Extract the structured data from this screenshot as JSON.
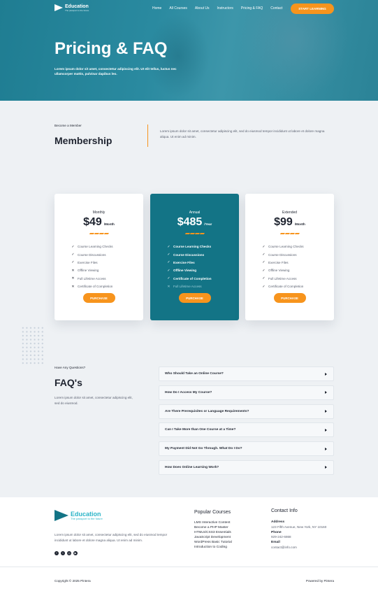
{
  "nav": {
    "logo_name": "Education",
    "logo_tagline": "The passport to the future",
    "links": [
      "Home",
      "All Courses",
      "About Us",
      "Instructors",
      "Pricing & FAQ",
      "Contact"
    ],
    "cta": "START LEARNING"
  },
  "hero": {
    "title": "Pricing & FAQ",
    "subtitle": "Lorem ipsum dolor sit amet, consectetur adipiscing elit. Ut elit tellus, luctus nec ullamcorper mattis, pulvinar dapibus leo."
  },
  "membership": {
    "eyebrow": "Become a Member",
    "title": "Membership",
    "text": "Lorem ipsum dolor sit amet, consectetur adipiscing elit, sed do eiusmod tempor incididunt ut labore et dolore magna aliqua. Ut enim ad minim."
  },
  "plans": [
    {
      "name": "Monthly",
      "price": "$49",
      "period": "/Month",
      "button": "PURCHASE",
      "features": [
        {
          "label": "Course Learning Checks",
          "included": true
        },
        {
          "label": "Course Discussions",
          "included": true
        },
        {
          "label": "Exercise Files",
          "included": true
        },
        {
          "label": "Offline Viewing",
          "included": false
        },
        {
          "label": "Full Lifetime Access",
          "included": false
        },
        {
          "label": "Certificate of Completion",
          "included": false
        }
      ]
    },
    {
      "name": "Annual",
      "price": "$485",
      "period": "/Year",
      "button": "PURCHASE",
      "features": [
        {
          "label": "Course Learning Checks",
          "included": true
        },
        {
          "label": "Course Discussions",
          "included": true
        },
        {
          "label": "Exercise Files",
          "included": true
        },
        {
          "label": "Offline Viewing",
          "included": true
        },
        {
          "label": "Certificate of Completion",
          "included": true
        },
        {
          "label": "Full Lifetime Access",
          "included": false
        }
      ]
    },
    {
      "name": "Extended",
      "price": "$99",
      "period": "/Month",
      "button": "PURCHASE",
      "features": [
        {
          "label": "Course Learning Checks",
          "included": true
        },
        {
          "label": "Course Discussions",
          "included": true
        },
        {
          "label": "Exercise Files",
          "included": true
        },
        {
          "label": "Offline Viewing",
          "included": true
        },
        {
          "label": "Full Lifetime Access",
          "included": true
        },
        {
          "label": "Certificate of Completion",
          "included": true
        }
      ]
    }
  ],
  "faq": {
    "eyebrow": "Have Any Questions?",
    "title": "FAQ's",
    "text": "Lorem ipsum dolor sit amet, consectetur adipiscing elit, sed do eiusmod.",
    "questions": [
      "Who Should Take an Online Course?",
      "How Do I Access My Course?",
      "Are There Prerequisites or Language Requirements?",
      "Can I Take More than One Course at a Time?",
      "My Payment Did Not Go Through. What Do I Do?",
      "How Does Online Learning Work?"
    ]
  },
  "footer": {
    "logo_name": "Education",
    "logo_tagline": "The passport to the future",
    "about": "Lorem ipsum dolor sit amet, consectetur adipiscing elit, sed do eiusmod tempor incididunt ut labore et dolore magna aliqua. Ut enim ad minim.",
    "social_icons": [
      "facebook-icon",
      "twitter-icon",
      "dribbble-icon",
      "youtube-icon"
    ],
    "courses_title": "Popular Courses",
    "courses": [
      "LMS Interactive Content",
      "Become a PHP Master",
      "HTML5/CSS3 Essentials",
      "JavaScript Development",
      "WordPress Basic Tutorial",
      "Introduction to Coding"
    ],
    "contact_title": "Contact Info",
    "address_label": "Address",
    "address": "123 Fifth Avenue, New York, NY 10160",
    "phone_label": "Phone",
    "phone": "929-242-6868",
    "email_label": "Email",
    "email": "contact@info.com",
    "copyright": "Copyright © 2025 Pintera",
    "powered": "Powered by Pintera"
  },
  "colors": {
    "accent": "#f7941d",
    "brand_teal": "#137486",
    "hero_teal": "#2a8aa0"
  }
}
